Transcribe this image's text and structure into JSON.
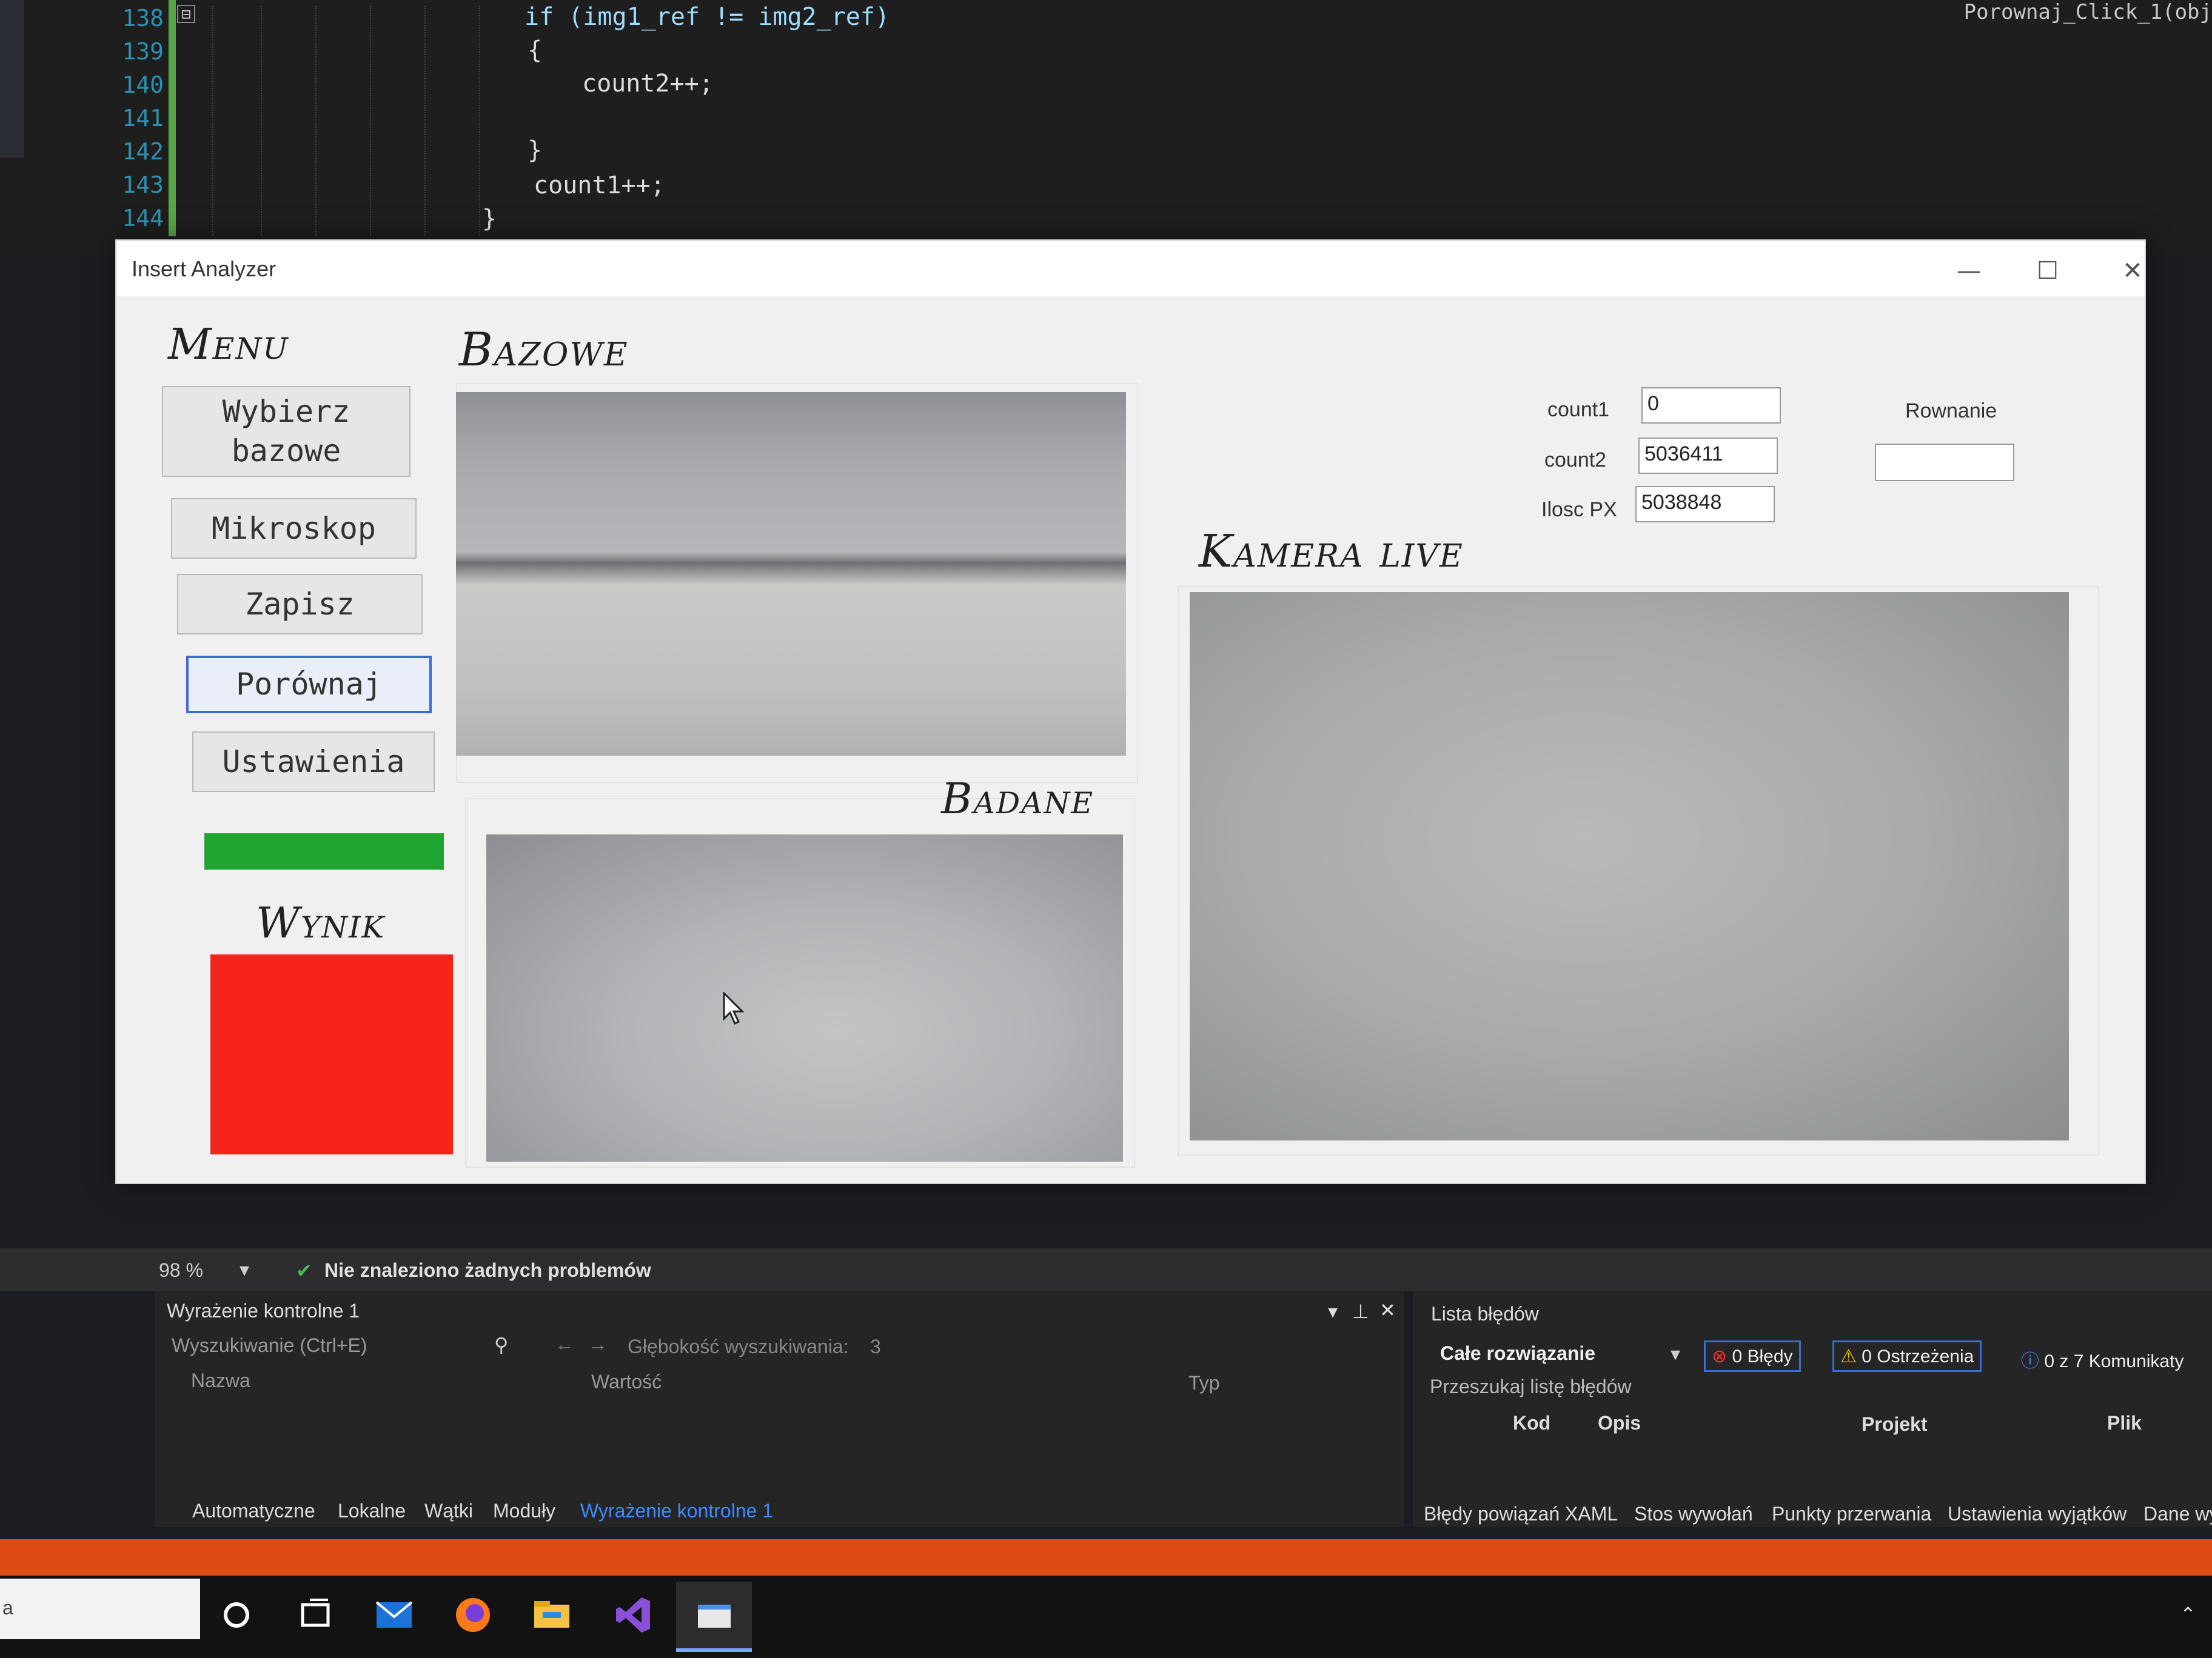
{
  "editor": {
    "lines": [
      {
        "num": "138",
        "code": "if (img1_ref != img2_ref)"
      },
      {
        "num": "139",
        "code": "{"
      },
      {
        "num": "140",
        "code": "count2++;"
      },
      {
        "num": "141",
        "code": ""
      },
      {
        "num": "142",
        "code": "}"
      },
      {
        "num": "143",
        "code": "count1++;"
      },
      {
        "num": "144",
        "code": "}"
      }
    ],
    "collapse_glyph": "⊟",
    "tab_hint": "Porownaj_Click_1(obj"
  },
  "window": {
    "title": "Insert Analyzer",
    "minimize": "—",
    "maximize": "☐",
    "close": "✕"
  },
  "menu": {
    "heading": "Menu",
    "buttons": {
      "select_base": "Wybierz\nbazowe",
      "microscope": "Mikroskop",
      "save": "Zapisz",
      "compare": "Porównaj",
      "settings": "Ustawienia"
    },
    "progress_fraction": 1.0,
    "progress_color": "#1fa531"
  },
  "result": {
    "heading": "Wynik",
    "color": "#f5231a"
  },
  "panels": {
    "base_heading": "Bazowe",
    "tested_heading": "Badane",
    "camera_heading": "Kamera live"
  },
  "fields": {
    "count1_label": "count1",
    "count1_value": "0",
    "count2_label": "count2",
    "count2_value": "5036411",
    "pixels_label": "Ilosc PX",
    "pixels_value": "5038848",
    "equation_label": "Rownanie",
    "equation_value": ""
  },
  "statusbar": {
    "zoom": "98 %",
    "problems": "Nie znaleziono żadnych problemów"
  },
  "watch": {
    "title": "Wyrażenie kontrolne 1",
    "search_placeholder": "Wyszukiwanie (Ctrl+E)",
    "depth_label": "Głębokość wyszukiwania:",
    "depth_value": "3",
    "columns": [
      "Nazwa",
      "Wartość",
      "Typ"
    ],
    "tabs": [
      "Automatyczne",
      "Lokalne",
      "Wątki",
      "Moduły",
      "Wyrażenie kontrolne 1"
    ]
  },
  "errors": {
    "title": "Lista błędów",
    "scope": "Całe rozwiązanie",
    "errors_badge": "0 Błędy",
    "warnings_badge": "0 Ostrzeżenia",
    "messages_badge": "0 z 7 Komunikaty",
    "search_placeholder": "Przeszukaj listę błędów",
    "columns": [
      "Kod",
      "Opis",
      "Projekt",
      "Plik"
    ],
    "tabs": [
      "Błędy powiązań XAML",
      "Stos wywołań",
      "Punkty przerwania",
      "Ustawienia wyjątków",
      "Dane wy"
    ]
  },
  "taskbar": {
    "search_text": "a",
    "icons": [
      "cortana-icon",
      "task-view-icon",
      "mail-icon",
      "firefox-icon",
      "file-explorer-icon",
      "visual-studio-icon",
      "app-window-icon"
    ]
  }
}
